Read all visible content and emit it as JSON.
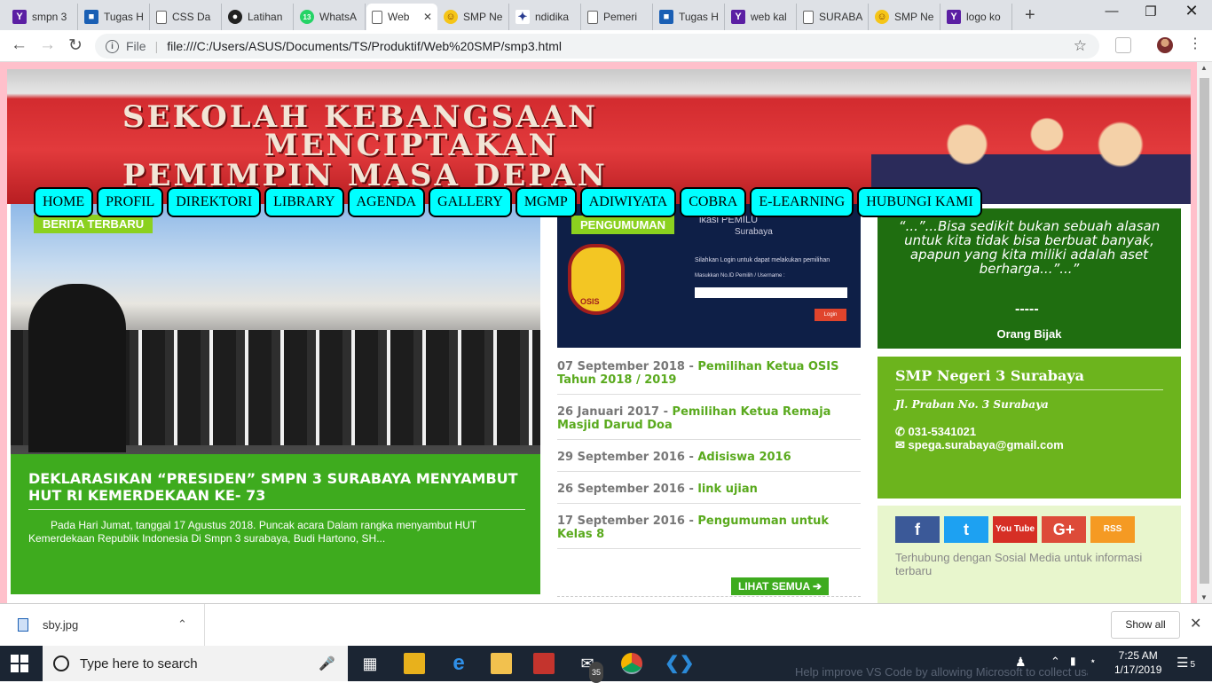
{
  "browser": {
    "tabs": [
      {
        "label": "smpn 3",
        "icon": "yahoo-icon"
      },
      {
        "label": "Tugas H",
        "icon": "profile-icon"
      },
      {
        "label": "CSS Da",
        "icon": "page-icon"
      },
      {
        "label": "Latihan",
        "icon": "github-icon"
      },
      {
        "label": "WhatsA",
        "icon": "whatsapp-icon",
        "badge": "13"
      },
      {
        "label": "Web",
        "icon": "page-icon",
        "active": true
      },
      {
        "label": "SMP Ne",
        "icon": "smiley-icon"
      },
      {
        "label": "ndidika",
        "icon": "emblem-icon"
      },
      {
        "label": "Pemeri",
        "icon": "page-icon"
      },
      {
        "label": "Tugas H",
        "icon": "profile-icon"
      },
      {
        "label": "web kal",
        "icon": "yahoo-icon"
      },
      {
        "label": "SURABA",
        "icon": "page-icon"
      },
      {
        "label": "SMP Ne",
        "icon": "smiley-icon"
      },
      {
        "label": "logo ko",
        "icon": "yahoo-icon"
      }
    ],
    "new_tab": "+",
    "address": {
      "scheme": "File",
      "url": "file:///C:/Users/ASUS/Documents/TS/Produktif/Web%20SMP/smp3.html"
    }
  },
  "site": {
    "banner": {
      "line1": "SEKOLAH KEBANGSAAN",
      "line2": "MENCIPTAKAN",
      "line3": "PEMIMPIN MASA DEPAN"
    },
    "menu": [
      "HOME",
      "PROFIL",
      "DIREKTORI",
      "LIBRARY",
      "AGENDA",
      "GALLERY",
      "MGMP",
      "ADIWIYATA",
      "COBRA",
      "E-LEARNING",
      "HUBUNGI KAMI"
    ],
    "news": {
      "tag": "BERITA TERBARU",
      "headline": "DEKLARASIKAN “PRESIDEN” SMPN 3 SURABAYA MENYAMBUT HUT RI KEMERDEKAAN KE- 73",
      "excerpt": "Pada Hari Jumat, tanggal 17 Agustus 2018. Puncak acara Dalam rangka menyambut HUT Kemerdekaan Republik Indonesia Di Smpn 3 surabaya, Budi Hartono, SH..."
    },
    "announcement": {
      "tag": "PENGUMUMAN",
      "image_text": {
        "top": "ikasi PEMILU",
        "sub": "Surabaya",
        "login_prompt": "Silahkan Login untuk dapat melakukan pemilihan",
        "field_label": "Masukkan No.ID Pemilih / Username :",
        "button": "Login",
        "seal": "OSIS"
      },
      "items": [
        {
          "date": "07 September 2018",
          "title": "Pemilihan Ketua OSIS Tahun 2018 / 2019"
        },
        {
          "date": "26 Januari 2017",
          "title": "Pemilihan Ketua Remaja Masjid Darud Doa"
        },
        {
          "date": "29 September 2016",
          "title": "Adisiswa 2016"
        },
        {
          "date": "26 September 2016",
          "title": "link ujian"
        },
        {
          "date": "17 September 2016",
          "title": "Pengumuman untuk Kelas 8"
        }
      ],
      "more": "LIHAT SEMUA ➔"
    },
    "quote": {
      "text": "“...”...Bisa sedikit bukan sebuah alasan untuk kita tidak bisa berbuat banyak, apapun yang kita miliki adalah aset berharga...”...”",
      "dash": "-----",
      "author": "Orang Bijak"
    },
    "contact": {
      "name": "SMP Negeri 3 Surabaya",
      "address": "Jl. Praban No. 3 Surabaya",
      "phone": "031-5341021",
      "email": "spega.surabaya@gmail.com"
    },
    "social": {
      "buttons": [
        {
          "name": "facebook",
          "glyph": "f",
          "color": "#3b5998"
        },
        {
          "name": "twitter",
          "glyph": "t",
          "color": "#1da1f2"
        },
        {
          "name": "youtube",
          "glyph": "You Tube",
          "color": "#d62f25"
        },
        {
          "name": "googleplus",
          "glyph": "G+",
          "color": "#dd4b39"
        },
        {
          "name": "rss",
          "glyph": "RSS",
          "color": "#f59a23"
        }
      ],
      "caption": "Terhubung dengan Sosial Media untuk informasi terbaru"
    }
  },
  "downloads": {
    "file": "sby.jpg",
    "show_all": "Show all"
  },
  "taskbar": {
    "search_placeholder": "Type here to search",
    "mail_badge": "35",
    "time": "7:25 AM",
    "date": "1/17/2019",
    "notification_count": "5",
    "vscode_notice": "Help improve VS Code by allowing Microsoft to collect usage data"
  }
}
